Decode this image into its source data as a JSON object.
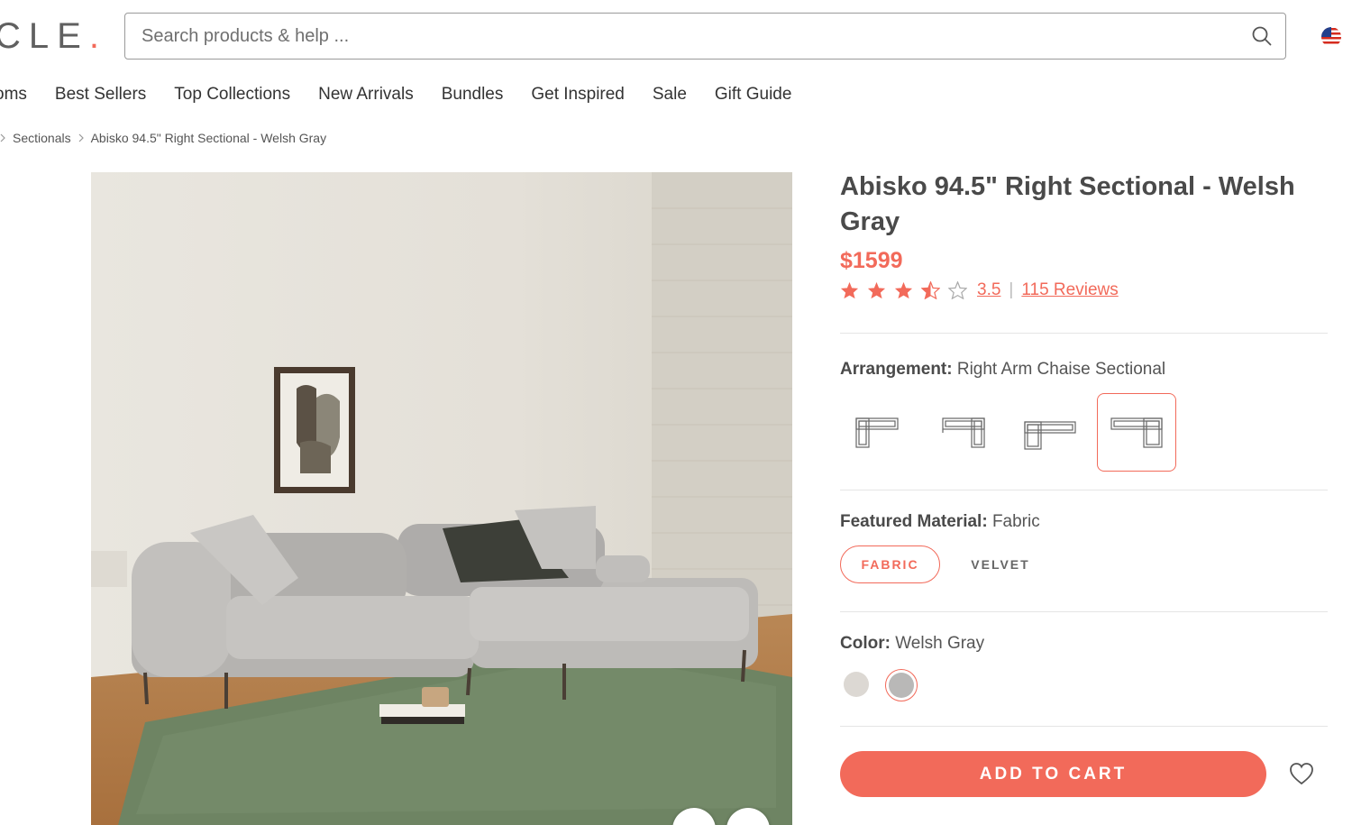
{
  "header": {
    "logo_text": "CLE",
    "logo_dot": ".",
    "search_placeholder": "Search products & help ...",
    "flag_icon": "us-flag-icon"
  },
  "nav": {
    "items": [
      "oms",
      "Best Sellers",
      "Top Collections",
      "New Arrivals",
      "Bundles",
      "Get Inspired",
      "Sale",
      "Gift Guide"
    ]
  },
  "breadcrumb": {
    "items": [
      "Sectionals",
      "Abisko 94.5\" Right Sectional - Welsh Gray"
    ]
  },
  "product": {
    "title": "Abisko 94.5\" Right Sectional - Welsh Gray",
    "price": "$1599",
    "rating_value": "3.5",
    "rating_separator": "|",
    "reviews_label": "115 Reviews",
    "stars_filled": 3.5,
    "stars_total": 5
  },
  "arrangement": {
    "label": "Arrangement:",
    "value": "Right Arm Chaise Sectional",
    "options": [
      "left-chaise-icon",
      "right-sectional-icon",
      "left-sectional-icon",
      "right-arm-chaise-icon"
    ],
    "selected_index": 3
  },
  "material": {
    "label": "Featured Material:",
    "value": "Fabric",
    "options": [
      "FABRIC",
      "VELVET"
    ],
    "selected_index": 0
  },
  "color": {
    "label": "Color:",
    "value": "Welsh Gray",
    "swatches": [
      "#dcd8d3",
      "#b9b8b7"
    ],
    "selected_index": 1
  },
  "actions": {
    "add_to_cart": "ADD TO CART",
    "wishlist_icon": "heart-icon"
  },
  "colors": {
    "accent": "#f26a5a",
    "text": "#4a4a4a"
  }
}
